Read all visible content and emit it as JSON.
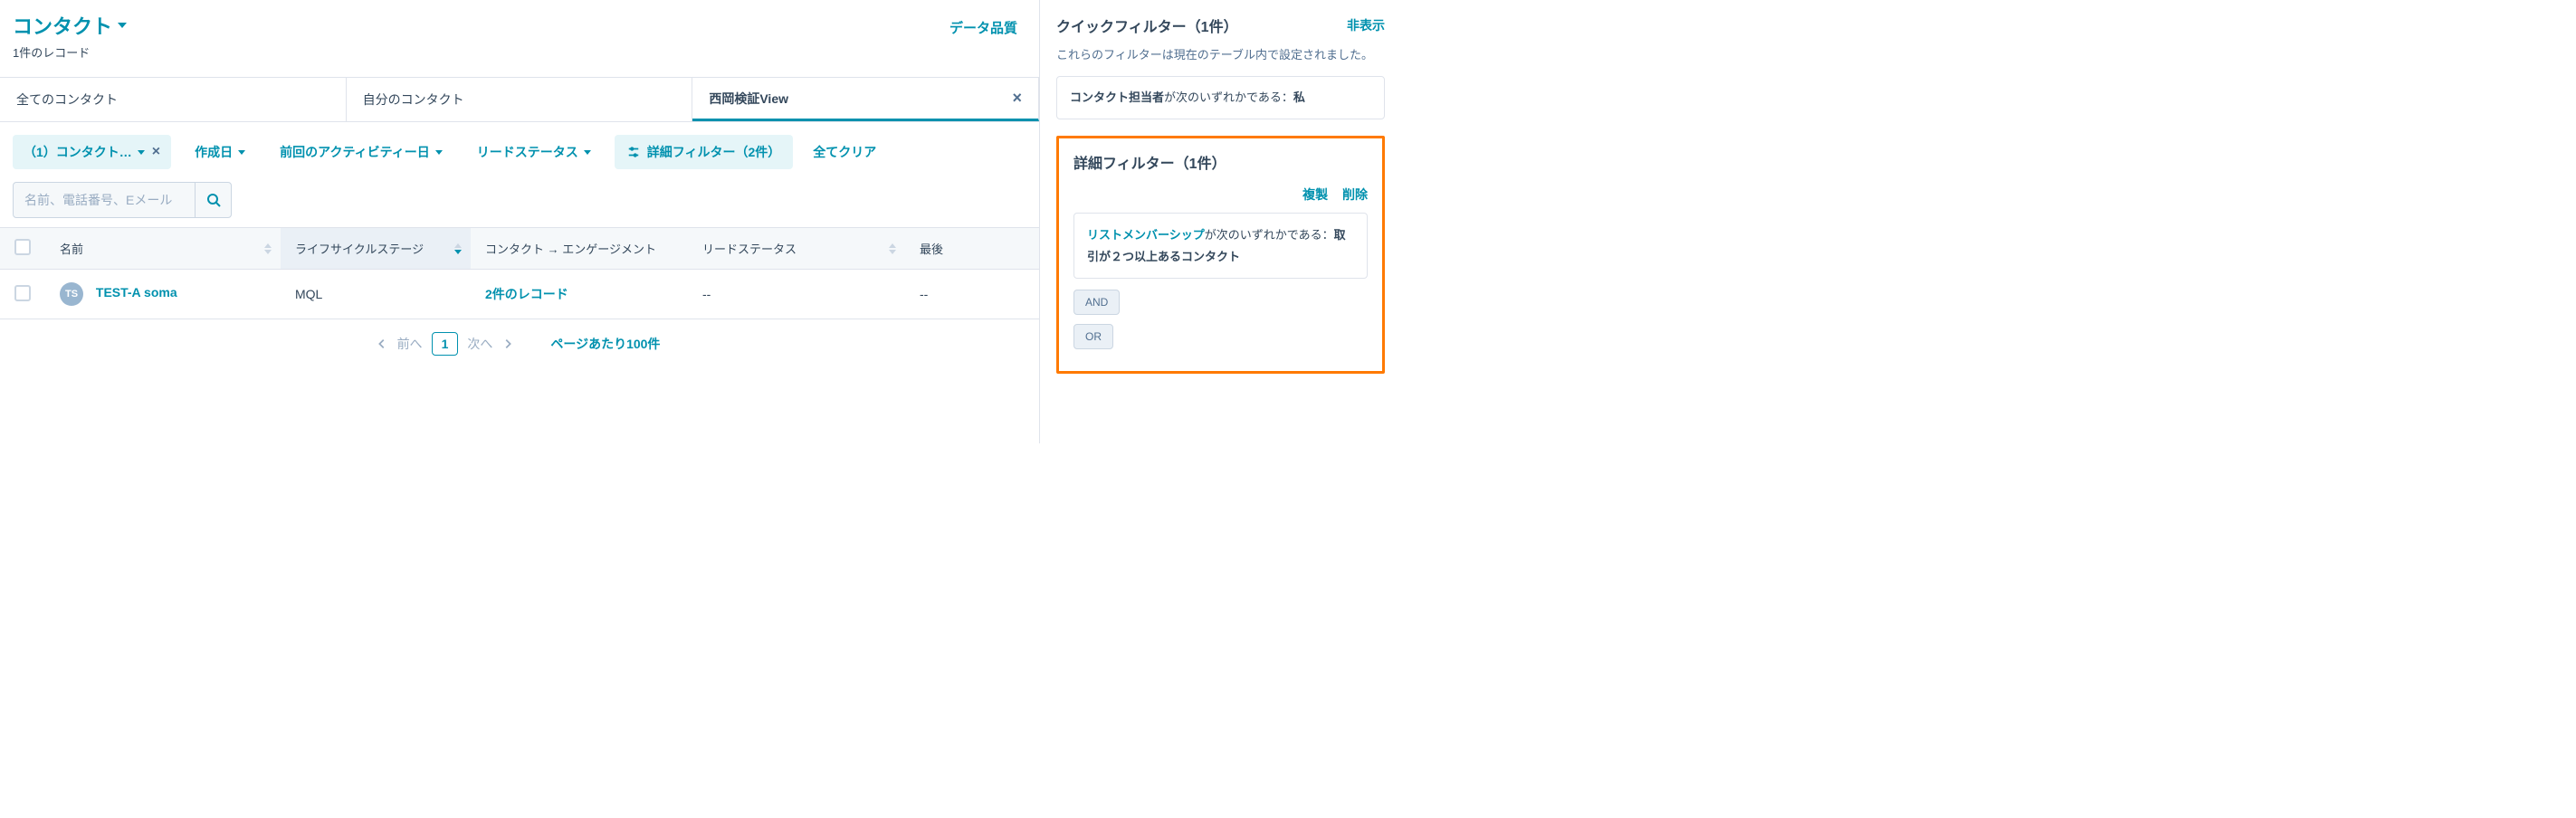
{
  "header": {
    "title": "コンタクト",
    "subtitle": "1件のレコード",
    "data_quality": "データ品質"
  },
  "tabs": [
    {
      "label": "全てのコンタクト",
      "active": false,
      "closable": false
    },
    {
      "label": "自分のコンタクト",
      "active": false,
      "closable": false
    },
    {
      "label": "西岡検証View",
      "active": true,
      "closable": true
    }
  ],
  "filters": {
    "chip1": "（1）コンタクト…",
    "created": "作成日",
    "activity": "前回のアクティビティー日",
    "lead_status": "リードステータス",
    "advanced": "詳細フィルター（2件）",
    "clear_all": "全てクリア"
  },
  "search": {
    "placeholder": "名前、電話番号、Eメール"
  },
  "columns": {
    "name": "名前",
    "lifecycle": "ライフサイクルステージ",
    "engagement": "コンタクト → エンゲージメント",
    "lead_status": "リードステータス",
    "last": "最後"
  },
  "rows": [
    {
      "avatar": "TS",
      "name": "TEST-A soma",
      "lifecycle": "MQL",
      "engagement": "2件のレコード",
      "lead_status": "--",
      "last": "--"
    }
  ],
  "pagination": {
    "prev": "前へ",
    "page": "1",
    "next": "次へ",
    "per_page": "ページあたり100件"
  },
  "right_panel": {
    "quick_title": "クイックフィルター（1件）",
    "hide": "非表示",
    "quick_desc": "これらのフィルターは現在のテーブル内で設定されました。",
    "quick_filter_prop": "コンタクト担当者",
    "quick_filter_op": "が次のいずれかである：",
    "quick_filter_val": "私",
    "adv_title": "詳細フィルター（1件）",
    "action_clone": "複製",
    "action_delete": "削除",
    "adv_prop": "リストメンバーシップ",
    "adv_op": "が次のいずれかである：",
    "adv_val": "取引が２つ以上あるコンタクト",
    "and": "AND",
    "or": "OR"
  }
}
